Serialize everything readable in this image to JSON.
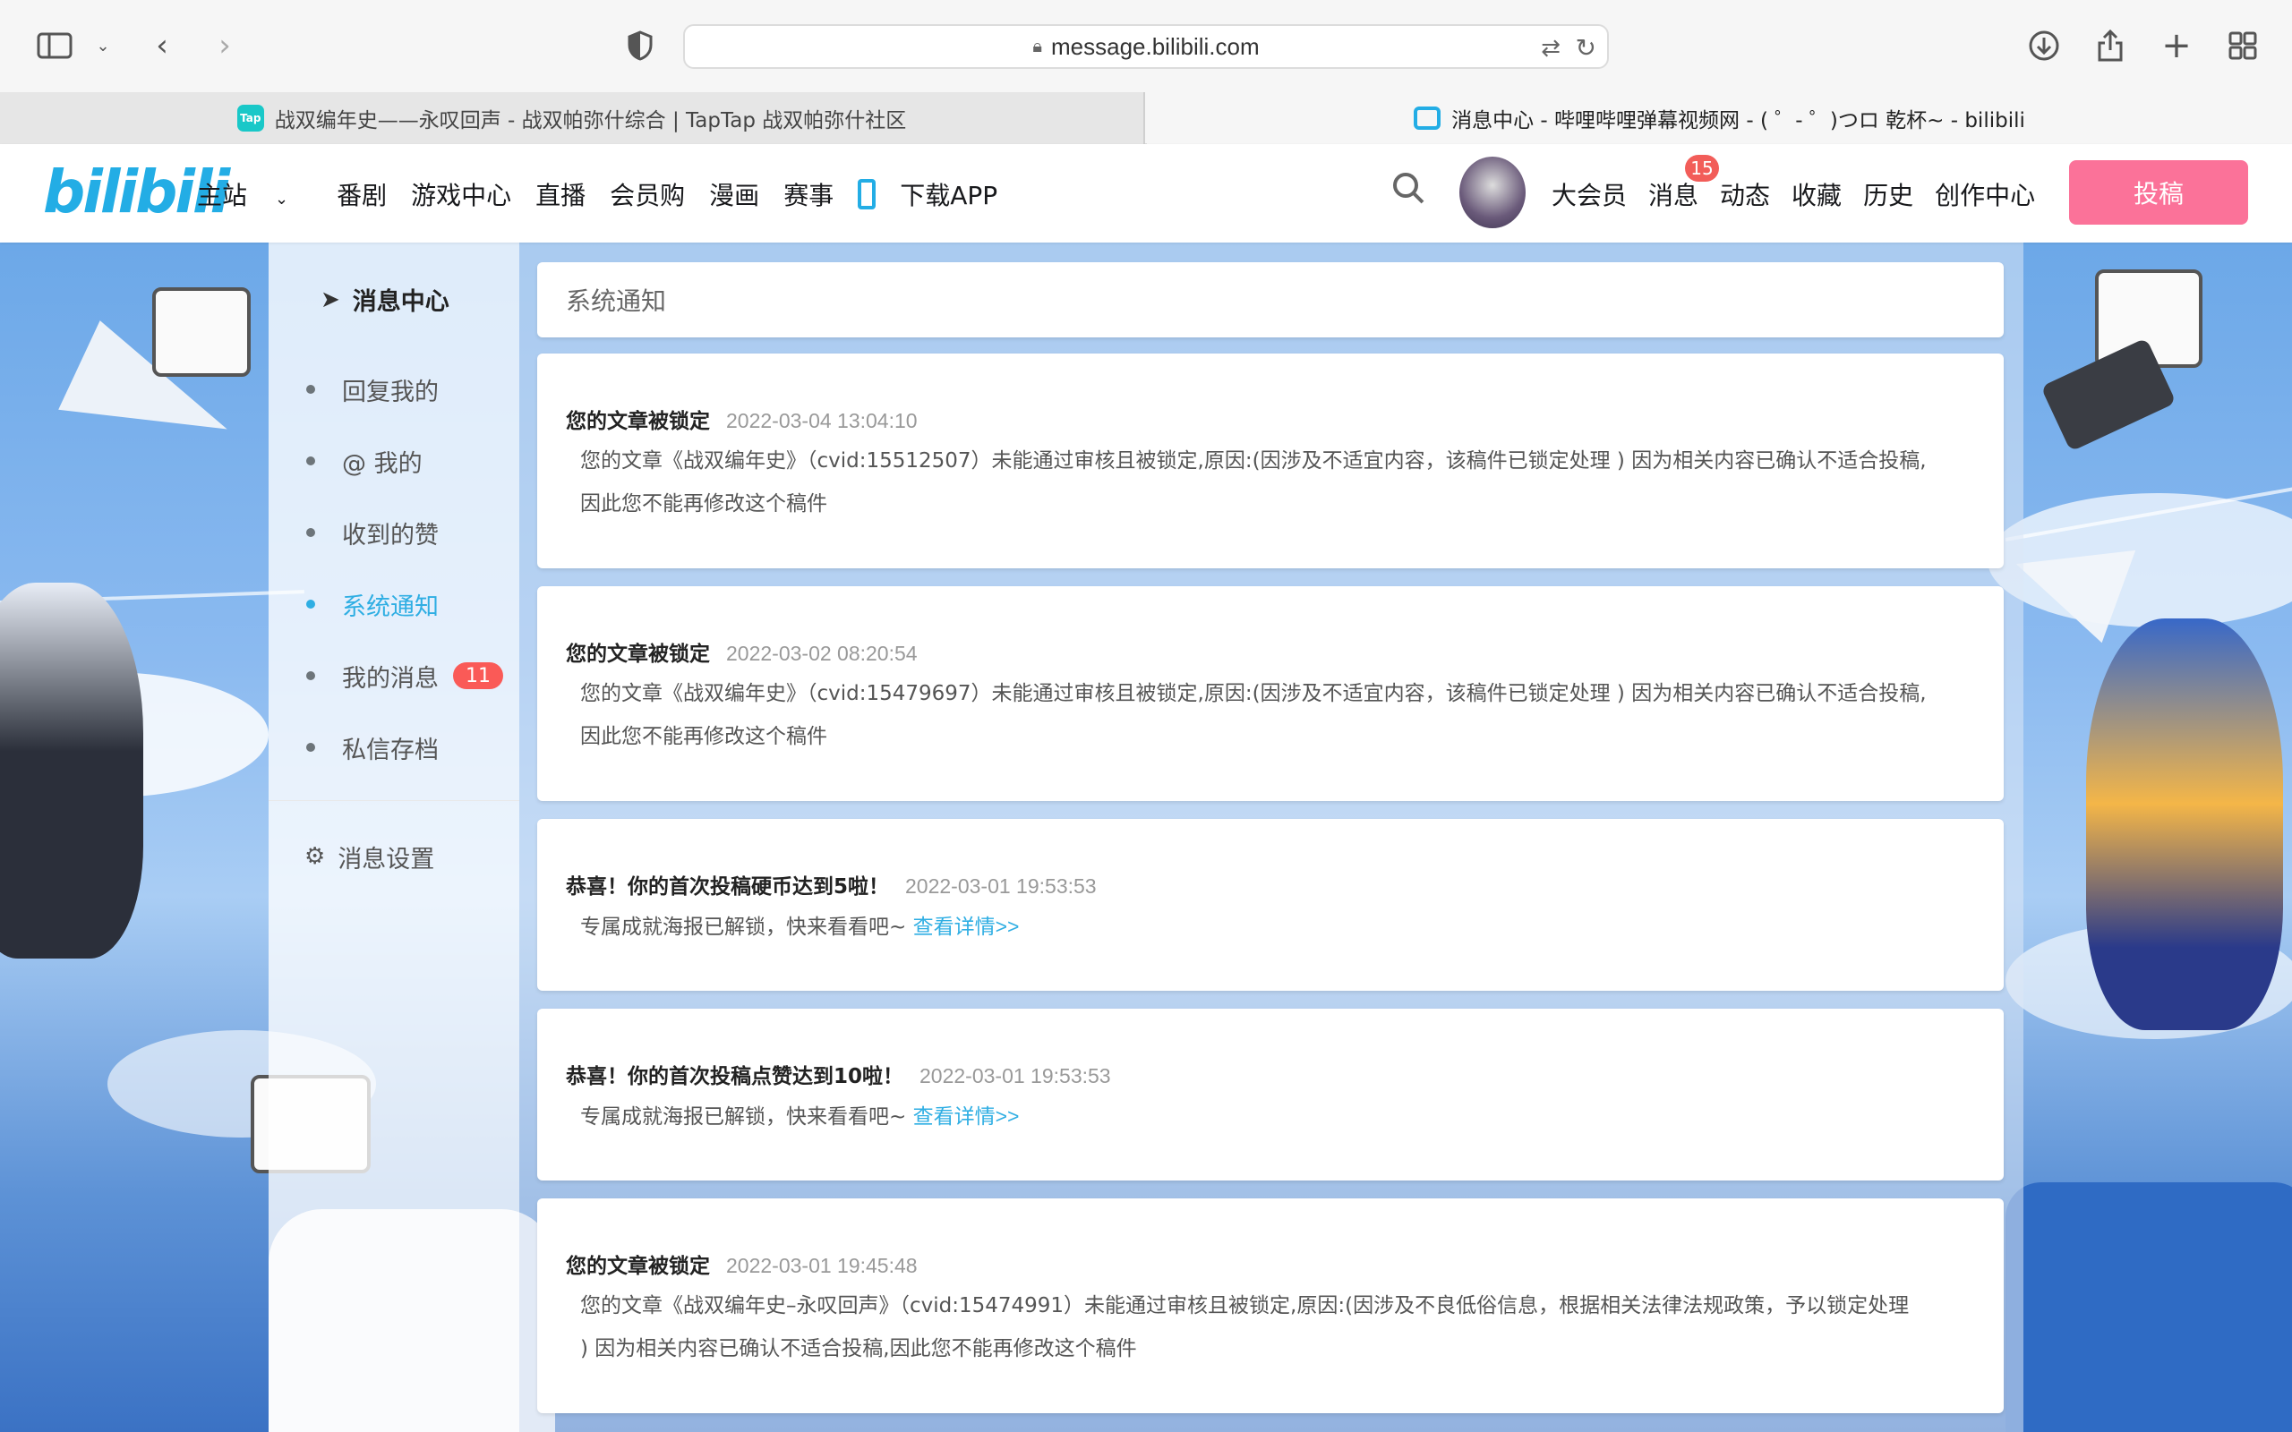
{
  "browser": {
    "url": "message.bilibili.com",
    "tabs": [
      {
        "label": "战双编年史——永叹回声 - 战双帕弥什综合 | TapTap 战双帕弥什社区",
        "favicon": "taptap-icon"
      },
      {
        "label": "消息中心 - 哔哩哔哩弹幕视频网 - ( ゜- ゜)つロ 乾杯~ - bilibili",
        "favicon": "bilibili-icon"
      }
    ]
  },
  "header": {
    "logo": "bilibili",
    "nav_left": [
      "主站",
      "番剧",
      "游戏中心",
      "直播",
      "会员购",
      "漫画",
      "赛事",
      "下载APP"
    ],
    "nav_right": [
      "大会员",
      "消息",
      "动态",
      "收藏",
      "历史",
      "创作中心"
    ],
    "message_badge": "15",
    "upload_label": "投稿",
    "colors": {
      "brand": "#23ade5",
      "upload": "#fb7299"
    }
  },
  "sidebar": {
    "title": "消息中心",
    "items": [
      {
        "label": "回复我的"
      },
      {
        "label": "@ 我的"
      },
      {
        "label": "收到的赞"
      },
      {
        "label": "系统通知",
        "active": true
      },
      {
        "label": "我的消息",
        "badge": "11"
      },
      {
        "label": "私信存档"
      }
    ],
    "settings_label": "消息设置",
    "active_color": "#2faee3"
  },
  "main": {
    "header": "系统通知",
    "notifications": [
      {
        "title": "您的文章被锁定",
        "time": "2022-03-04 13:04:10",
        "lines": [
          "您的文章《战双编年史》（cvid:15512507）未能通过审核且被锁定,原因:(因涉及不适宜内容，该稿件已锁定处理 ) 因为相关内容已确认不适合投稿,",
          "因此您不能再修改这个稿件"
        ]
      },
      {
        "title": "您的文章被锁定",
        "time": "2022-03-02 08:20:54",
        "lines": [
          "您的文章《战双编年史》（cvid:15479697）未能通过审核且被锁定,原因:(因涉及不适宜内容，该稿件已锁定处理 ) 因为相关内容已确认不适合投稿,",
          "因此您不能再修改这个稿件"
        ]
      },
      {
        "title": "恭喜！你的首次投稿硬币达到5啦！",
        "time": "2022-03-01 19:53:53",
        "lines": [
          "专属成就海报已解锁，快来看看吧~ "
        ],
        "link": "查看详情>>"
      },
      {
        "title": "恭喜！你的首次投稿点赞达到10啦！",
        "time": "2022-03-01 19:53:53",
        "lines": [
          "专属成就海报已解锁，快来看看吧~ "
        ],
        "link": "查看详情>>"
      },
      {
        "title": "您的文章被锁定",
        "time": "2022-03-01 19:45:48",
        "lines": [
          "您的文章《战双编年史–永叹回声》（cvid:15474991）未能通过审核且被锁定,原因:(因涉及不良低俗信息，根据相关法律法规政策，予以锁定处理",
          ") 因为相关内容已确认不适合投稿,因此您不能再修改这个稿件"
        ]
      }
    ]
  }
}
